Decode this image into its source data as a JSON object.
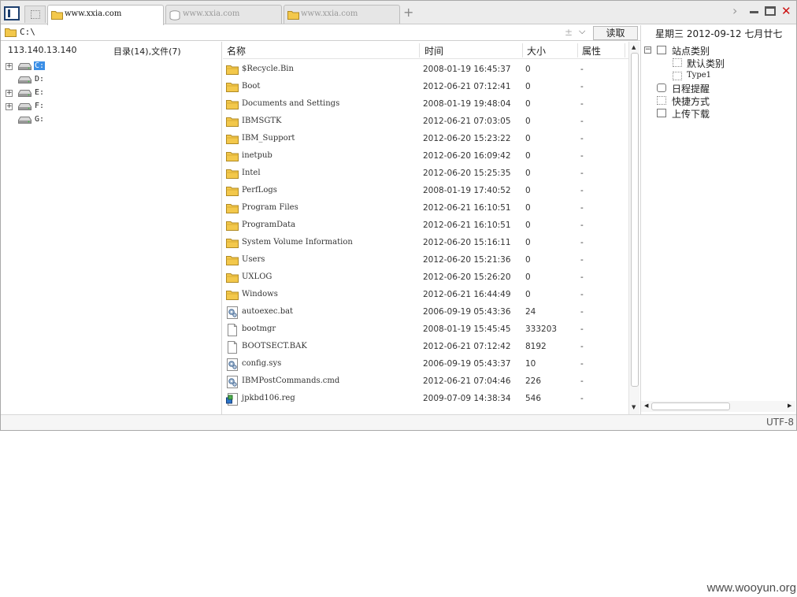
{
  "tabs": [
    {
      "label": "www.xxia.com",
      "active": true
    },
    {
      "label": "www.xxia.com",
      "active": false
    },
    {
      "label": "www.xxia.com",
      "active": false
    }
  ],
  "address": {
    "path": "C:\\",
    "plus_minus": "±",
    "dropdown": "⌵",
    "read_button": "读取"
  },
  "left_panel": {
    "ip": "113.140.13.140",
    "counts": "目录(14),文件(7)",
    "drives": [
      {
        "label": "C:",
        "expandable": true,
        "selected": true
      },
      {
        "label": "D:",
        "expandable": false,
        "selected": false
      },
      {
        "label": "E:",
        "expandable": true,
        "selected": false
      },
      {
        "label": "F:",
        "expandable": true,
        "selected": false
      },
      {
        "label": "G:",
        "expandable": false,
        "selected": false
      }
    ]
  },
  "file_list": {
    "columns": {
      "name": "名称",
      "time": "时间",
      "size": "大小",
      "attr": "属性"
    },
    "rows": [
      {
        "icon": "folder",
        "name": "$Recycle.Bin",
        "time": "2008-01-19 16:45:37",
        "size": "0",
        "attr": "-"
      },
      {
        "icon": "folder",
        "name": "Boot",
        "time": "2012-06-21 07:12:41",
        "size": "0",
        "attr": "-"
      },
      {
        "icon": "folder",
        "name": "Documents and Settings",
        "time": "2008-01-19 19:48:04",
        "size": "0",
        "attr": "-"
      },
      {
        "icon": "folder",
        "name": "IBMSGTK",
        "time": "2012-06-21 07:03:05",
        "size": "0",
        "attr": "-"
      },
      {
        "icon": "folder",
        "name": "IBM_Support",
        "time": "2012-06-20 15:23:22",
        "size": "0",
        "attr": "-"
      },
      {
        "icon": "folder",
        "name": "inetpub",
        "time": "2012-06-20 16:09:42",
        "size": "0",
        "attr": "-"
      },
      {
        "icon": "folder",
        "name": "Intel",
        "time": "2012-06-20 15:25:35",
        "size": "0",
        "attr": "-"
      },
      {
        "icon": "folder",
        "name": "PerfLogs",
        "time": "2008-01-19 17:40:52",
        "size": "0",
        "attr": "-"
      },
      {
        "icon": "folder",
        "name": "Program Files",
        "time": "2012-06-21 16:10:51",
        "size": "0",
        "attr": "-"
      },
      {
        "icon": "folder",
        "name": "ProgramData",
        "time": "2012-06-21 16:10:51",
        "size": "0",
        "attr": "-"
      },
      {
        "icon": "folder",
        "name": "System Volume Information",
        "time": "2012-06-20 15:16:11",
        "size": "0",
        "attr": "-"
      },
      {
        "icon": "folder",
        "name": "Users",
        "time": "2012-06-20 15:21:36",
        "size": "0",
        "attr": "-"
      },
      {
        "icon": "folder",
        "name": "UXLOG",
        "time": "2012-06-20 15:26:20",
        "size": "0",
        "attr": "-"
      },
      {
        "icon": "folder",
        "name": "Windows",
        "time": "2012-06-21 16:44:49",
        "size": "0",
        "attr": "-"
      },
      {
        "icon": "gear-file",
        "name": "autoexec.bat",
        "time": "2006-09-19 05:43:36",
        "size": "24",
        "attr": "-"
      },
      {
        "icon": "file",
        "name": "bootmgr",
        "time": "2008-01-19 15:45:45",
        "size": "333203",
        "attr": "-"
      },
      {
        "icon": "file",
        "name": "BOOTSECT.BAK",
        "time": "2012-06-21 07:12:42",
        "size": "8192",
        "attr": "-"
      },
      {
        "icon": "gear-file",
        "name": "config.sys",
        "time": "2006-09-19 05:43:37",
        "size": "10",
        "attr": "-"
      },
      {
        "icon": "gear-file",
        "name": "IBMPostCommands.cmd",
        "time": "2012-06-21 07:04:46",
        "size": "226",
        "attr": "-"
      },
      {
        "icon": "reg-file",
        "name": "jpkbd106.reg",
        "time": "2009-07-09 14:38:34",
        "size": "546",
        "attr": "-"
      }
    ]
  },
  "right_panel": {
    "date_line": "星期三  2012-09-12  七月廿七",
    "tree": {
      "site_categories": "站点类别",
      "default_category": "默认类别",
      "type1": "Type1",
      "schedule": "日程提醒",
      "shortcuts": "快捷方式",
      "upload_download": "上传下载"
    }
  },
  "status": {
    "encoding": "UTF-8"
  },
  "watermark": "www.wooyun.org",
  "colors": {
    "folder": "#f3c84b",
    "selection": "#3a8ee6",
    "close": "#cc1111"
  }
}
